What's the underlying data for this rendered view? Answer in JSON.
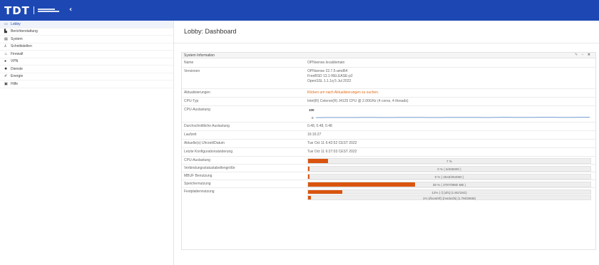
{
  "brand": {
    "logo_text": "TDT",
    "collapse_glyph": "‹"
  },
  "sidebar": {
    "items": [
      {
        "label": "Lobby",
        "icon": "laptop-icon",
        "glyph": "▭",
        "active": true
      },
      {
        "label": "Berichterstattung",
        "icon": "chart-icon",
        "glyph": "▙",
        "active": false
      },
      {
        "label": "System",
        "icon": "server-icon",
        "glyph": "▤",
        "active": false
      },
      {
        "label": "Schnittstellen",
        "icon": "sitemap-icon",
        "glyph": "⅄",
        "active": false
      },
      {
        "label": "Firewall",
        "icon": "fire-icon",
        "glyph": "♨",
        "active": false
      },
      {
        "label": "VPN",
        "icon": "globe-icon",
        "glyph": "●",
        "active": false
      },
      {
        "label": "Dienste",
        "icon": "cog-icon",
        "glyph": "✹",
        "active": false
      },
      {
        "label": "Energie",
        "icon": "plug-icon",
        "glyph": "✐",
        "active": false
      },
      {
        "label": "Hilfe",
        "icon": "help-icon",
        "glyph": "▣",
        "active": false
      }
    ]
  },
  "page": {
    "title": "Lobby: Dashboard"
  },
  "widget": {
    "title": "System Information",
    "tools": "✎ – ✖",
    "rows": {
      "name": {
        "label": "Name",
        "value": "OPNsense.localdomain"
      },
      "versions": {
        "label": "Versionen",
        "lines": [
          "OPNsense 22.7.5-amd64",
          "FreeBSD 13.1-RELEASE-p2",
          "OpenSSL 1.1.1q 5 Jul 2022"
        ]
      },
      "updates": {
        "label": "Aktualisierungen",
        "value": "Klicken um nach Aktualisierungen zu suchen."
      },
      "cpu_type": {
        "label": "CPU-Typ",
        "value": "Intel(R) Celeron(R) J4125 CPU @ 2.00GHz (4 cores, 4 threads)"
      },
      "cpu_graph": {
        "label": "CPU-Auslastung",
        "ymax_label": "100",
        "ymin_label": "0"
      },
      "load": {
        "label": "Durchschnittliche Auslastung",
        "value": "0.48, 0.48, 0.48"
      },
      "uptime": {
        "label": "Laufzeit",
        "value": "16:16:27"
      },
      "datetime": {
        "label": "Aktuelle(s) Uhrzeit/Datum",
        "value": "Tue Oct 11 6:42:52 CEST 2022"
      },
      "lastcfg": {
        "label": "Letzte Konfigurationsänderung",
        "value": "Tue Oct 11 6:27:03 CEST 2022"
      },
      "cpu_usage": {
        "label": "CPU-Auslastung",
        "text": "7 %",
        "percent": 7
      },
      "states": {
        "label": "Verbindungsstatustabellengröße",
        "text": "0 % ( 6/406000 )",
        "percent": 0
      },
      "mbuf": {
        "label": "MBUF Benutzung",
        "text": "0 % ( 2543/254050 )",
        "percent": 0
      },
      "memory": {
        "label": "Speichernutzung",
        "text": "38 % ( 3787/9980 MB )",
        "percent": 38
      },
      "disk": {
        "label": "Festplattennutzung",
        "text1": "12% ( /) [ufs] (1.8G/15G)",
        "percent1": 12,
        "text2": "1% (/boot/efi) [msdosfs] (1.7M/256M)",
        "percent2": 1
      }
    }
  },
  "chart_data": {
    "type": "line",
    "title": "",
    "ylim": [
      0,
      100
    ],
    "yticks": [
      "100",
      "0"
    ],
    "series": [
      {
        "values": [
          3,
          4,
          4,
          4,
          4,
          5,
          5,
          4,
          4,
          5,
          5,
          5,
          4,
          4,
          5,
          5,
          5,
          5,
          4,
          5,
          6,
          5,
          5,
          5,
          6,
          6,
          5,
          5,
          6,
          6
        ]
      }
    ]
  },
  "colors": {
    "topbar": "#1d48b4",
    "progress_fill": "#d9550f",
    "link": "#e06d1a"
  }
}
